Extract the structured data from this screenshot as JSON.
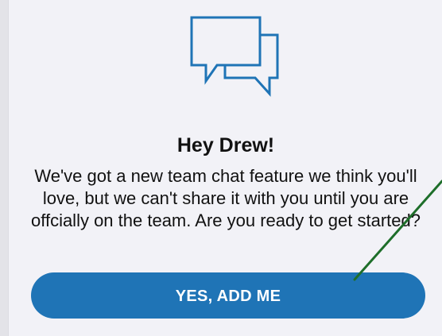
{
  "greeting": {
    "title": "Hey Drew!",
    "message": "We've got a new team chat feature we think you'll love, but we can't share it with you until you are offcially on the team. Are you ready to get started?"
  },
  "actions": {
    "primary_label": "YES, ADD ME"
  },
  "icons": {
    "hero": "chat-bubbles-icon"
  },
  "colors": {
    "accent": "#1f74b6",
    "icon_stroke": "#1f74b6",
    "annotation_stroke": "#1e6e2a",
    "background": "#f2f2f7"
  }
}
